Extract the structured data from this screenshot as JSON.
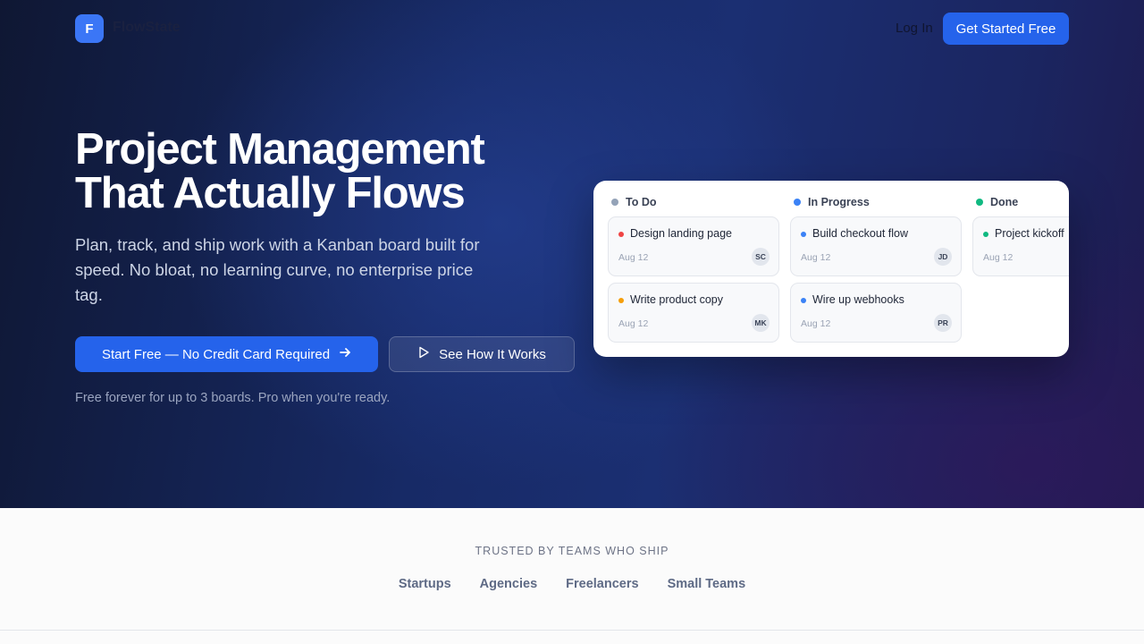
{
  "nav": {
    "logo_letter": "F",
    "brand_name": "FlowState",
    "login_label": "Log In",
    "cta_label": "Get Started Free"
  },
  "hero": {
    "headline_line1": "Project Management",
    "headline_line2": "That Actually Flows",
    "subhead": "Plan, track, and ship work with a Kanban board built for speed. No bloat, no learning curve, no enterprise price tag.",
    "primary_cta": "Start Free — No Credit Card Required",
    "secondary_cta": "See How It Works",
    "fineprint": "Free forever for up to 3 boards. Pro when you're ready."
  },
  "board": {
    "columns": [
      {
        "title": "To Do",
        "dot_color": "#94a3b8",
        "cards": [
          {
            "title": "Design landing page",
            "date": "Aug 12",
            "assignee": "SC",
            "dot_color": "#ef4444"
          },
          {
            "title": "Write product copy",
            "date": "Aug 12",
            "assignee": "MK",
            "dot_color": "#f59e0b"
          }
        ]
      },
      {
        "title": "In Progress",
        "dot_color": "#3b82f6",
        "cards": [
          {
            "title": "Build checkout flow",
            "date": "Aug 12",
            "assignee": "JD",
            "dot_color": "#3b82f6"
          },
          {
            "title": "Wire up webhooks",
            "date": "Aug 12",
            "assignee": "PR",
            "dot_color": "#3b82f6"
          }
        ]
      },
      {
        "title": "Done",
        "dot_color": "#10b981",
        "cards": [
          {
            "title": "Project kickoff",
            "date": "Aug 12",
            "assignee": "",
            "dot_color": "#10b981"
          }
        ]
      }
    ]
  },
  "trusted": {
    "label": "TRUSTED BY TEAMS WHO SHIP",
    "segments": [
      "Startups",
      "Agencies",
      "Freelancers",
      "Small Teams"
    ]
  },
  "colors": {
    "accent": "#2563eb",
    "logo": "#3b76f6"
  }
}
